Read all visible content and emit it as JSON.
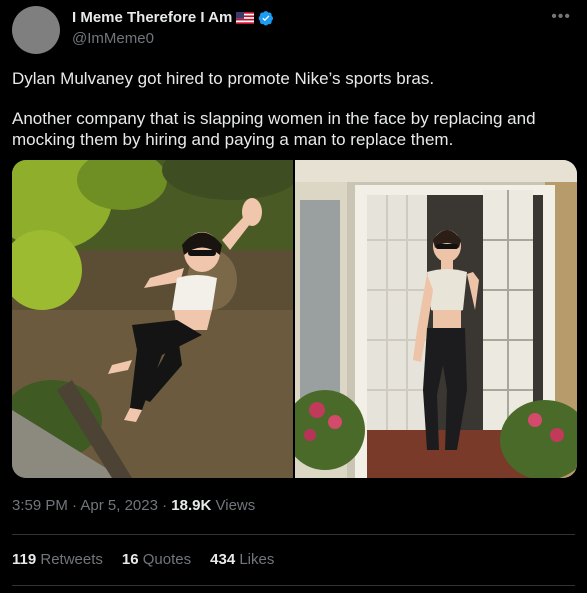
{
  "author": {
    "display_name": "I Meme Therefore I Am",
    "handle": "@ImMeme0",
    "flag_icon": "us-flag-icon",
    "verified_icon": "verified-badge-icon",
    "verified_color": "#1d9bf0"
  },
  "more_icon": "more-options-icon",
  "tweet": {
    "paragraph1": "Dylan Mulvaney got hired to promote Nike’s sports bras.",
    "paragraph2": "Another company that is slapping women in the face by replacing and mocking them by hiring and paying a man to replace them."
  },
  "media": {
    "count": 2
  },
  "meta": {
    "time": "3:59 PM",
    "separator": "·",
    "date": "Apr 5, 2023",
    "views_count": "18.9K",
    "views_label": "Views"
  },
  "stats": [
    {
      "count": "119",
      "label": "Retweets"
    },
    {
      "count": "16",
      "label": "Quotes"
    },
    {
      "count": "434",
      "label": "Likes"
    }
  ],
  "colors": {
    "background": "#000000",
    "text_primary": "#e7e9ea",
    "text_secondary": "#71767b",
    "divider": "#2f3336"
  }
}
